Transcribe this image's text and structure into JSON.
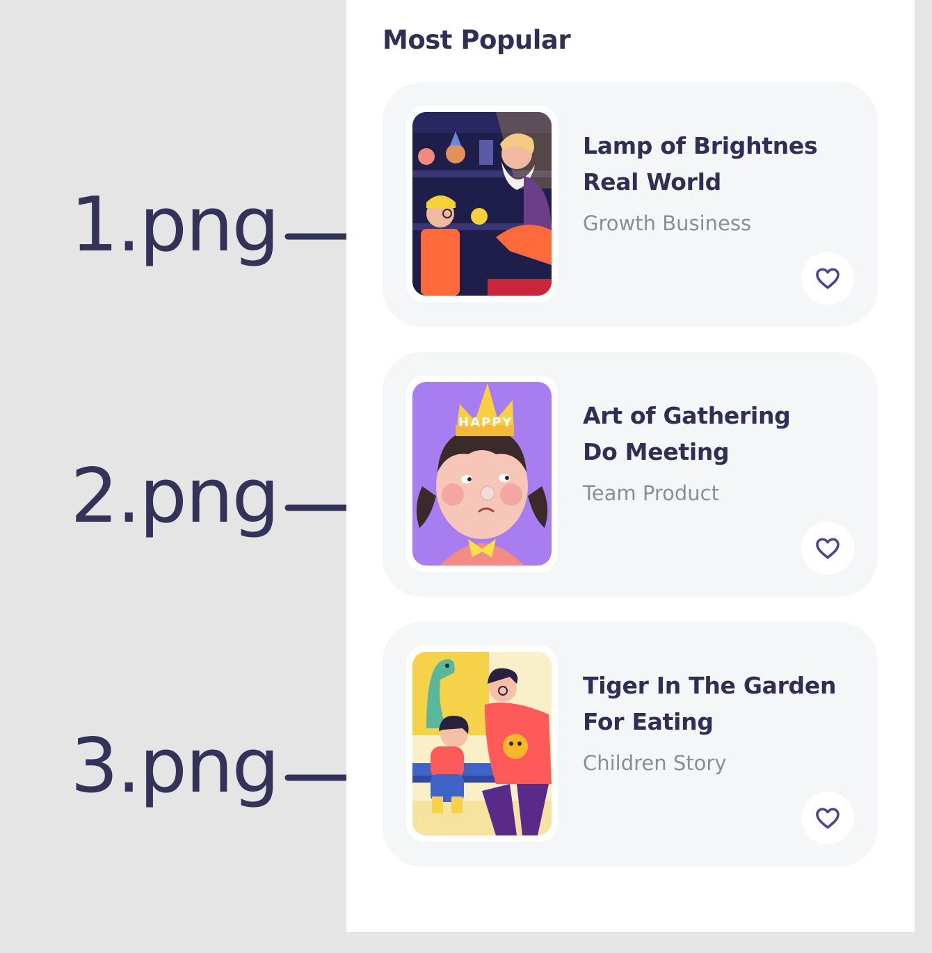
{
  "annotations": [
    {
      "label": "1.png"
    },
    {
      "label": "2.png"
    },
    {
      "label": "3.png"
    }
  ],
  "section": {
    "title": "Most Popular"
  },
  "books": [
    {
      "title_line1": "Lamp of Brightnes",
      "title_line2": "Real World",
      "category": "Growth Business",
      "icon": "heart-outline-icon"
    },
    {
      "title_line1": "Art of Gathering",
      "title_line2": "Do Meeting",
      "category": "Team Product",
      "icon": "heart-outline-icon"
    },
    {
      "title_line1": "Tiger In The Garden",
      "title_line2": "For Eating",
      "category": "Children Story",
      "icon": "heart-outline-icon"
    }
  ],
  "colors": {
    "background": "#e5e5e6",
    "panel": "#ffffff",
    "card": "#f5f6f8",
    "heading": "#2f2f55",
    "subtext": "#8c8c96",
    "accent": "#4b4494"
  }
}
